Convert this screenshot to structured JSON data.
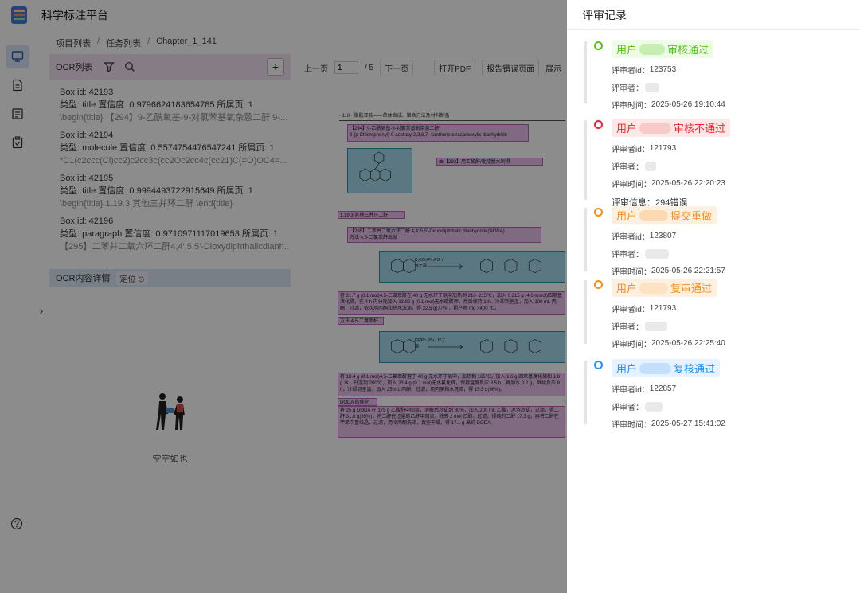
{
  "app": {
    "title": "科学标注平台",
    "breadcrumb": [
      "项目列表",
      "任务列表",
      "Chapter_1_141"
    ]
  },
  "ocr_panel": {
    "title": "OCR列表",
    "add_label": "+",
    "items": [
      {
        "box_id": "Box id: 42193",
        "meta": "类型: title   置信度: 0.9796624183654785   所属页: 1",
        "preview": "\\begin{title} 【294】9-乙酰氧基-9-对氯苯基氧杂蒽二酐 9-..."
      },
      {
        "box_id": "Box id: 42194",
        "meta": "类型: molecule   置信度: 0.5574754476547241   所属页: 1",
        "preview": "*C1(c2ccc(Cl)cc2)c2cc3c(cc2Oc2cc4c(cc21)C(=O)OC4=..."
      },
      {
        "box_id": "Box id: 42195",
        "meta": "类型: title   置信度: 0.9994493722915649   所属页: 1",
        "preview": "\\begin{title} 1.19.3 其他三并环二酐 \\end{title}"
      },
      {
        "box_id": "Box id: 42196",
        "meta": "类型: paragraph   置信度: 0.9710971117019653   所属页: 1",
        "preview": "【295】二苯并二氧六环二酐4,4',5,5'-Dioxydiphthalicdianh..."
      }
    ]
  },
  "detail_panel": {
    "title": "OCR内容详情",
    "locate_label": "定位",
    "empty_text": "空空如也"
  },
  "pdf_toolbar": {
    "prev": "上一页",
    "page": "1",
    "total": "/ 5",
    "next": "下一页",
    "open_pdf": "打开PDF",
    "report": "报告错误页面",
    "show": "展示"
  },
  "pdf_page": {
    "header": "· 118 ·                 聚酰亚胺——单体合成、聚合方法及材料制备",
    "boxes": [
      "【294】9-乙酰氧基-9-对氯苯基氧杂蒽二酐",
      "9-(p-Chlorophenyl)-9-acetoxy-2,3,6,7- xanthenetetracarboxylic dianhydride",
      "由【293】用乙酸酐/吡啶脱水制得",
      "1.19.3   其他三并环二酐",
      "【295】二苯并二氧六环二酐 4,4',5,5'-Dioxydiphthalic dianhydride(DODA)",
      "方法 4,5-二氯苯酐出发",
      "将 21.7 g (0.1 mol)4,5-二氯苯酐在 40 g 无水环丁砜中加热到 210~215℃，加入 0.215 g (4.6 mmol)四苯基溴化磷，在 4 h 内分批加入 13.82 g (0.1 mol)无水碳酸钾，然后保持 1 h。冷却到室温，加入 100 mL 丙酮，过滤，依次用丙酮和热水洗涤，得 32.5 g(77%)，粗产物 mp >400 ℃。",
      "方法 4,5-二溴苯酐出发",
      "将 18.4 g (0.1 mol)4,5-二氟苯酐溶于 40 g 无水环丁砜中，加热到 165℃，加入 1.6 g 四苯基溴化磷和 1.8 g 水，升温到 200℃，加入 23.4 g (0.1 mol)无水氟化钾，保持温度反应 3.5 h，再加水 0.2 g，继续反应 8 h，冷却到室温，加入 25 mL 丙酮，过滤，用丙酮和水洗涤，得 15.5 g(96%)。",
      "DODA 的纯化",
      "将 25 g DODA 在 175 g 乙酸酐中回流，溶解后冷却到 80%，加入 200 mL 乙酸，冰浴冷却，过滤，得二酐 31.0 g(85%)，将二酐在过量的乙酐中回流，除去 2 mol 乙酸，过滤，得纯的二酐 17.3 g，再将二酐在甲苯中重结晶，过滤，用冷丙酮洗涤，真空干燥，得 17.1 g 高纯 DODA。"
    ],
    "arrow1": "K₂CO₃/Ph₄PBr / 环丁砜",
    "arrow2": "KF/Ph₄PBr / 环丁砜"
  },
  "review": {
    "title": "评审记录",
    "records": [
      {
        "status": "green",
        "prefix": "用户",
        "action": "审核通过",
        "reviewer_id_label": "评审者id：",
        "reviewer_id": "123753",
        "reviewer_label": "评审者：",
        "time_label": "评审时间：",
        "time": "2025-05-26 19:10:44"
      },
      {
        "status": "red",
        "prefix": "用户",
        "action": "审核不通过",
        "reviewer_id_label": "评审者id：",
        "reviewer_id": "121793",
        "reviewer_label": "评审者：",
        "time_label": "评审时间：",
        "time": "2025-05-26 22:20:23",
        "info_label": "评审信息：",
        "info": "294错误"
      },
      {
        "status": "orange",
        "prefix": "用户",
        "action": "提交重做",
        "reviewer_id_label": "评审者id：",
        "reviewer_id": "123807",
        "reviewer_label": "评审者：",
        "time_label": "评审时间：",
        "time": "2025-05-26 22:21:57"
      },
      {
        "status": "orange",
        "prefix": "用户",
        "action": "复审通过",
        "reviewer_id_label": "评审者id：",
        "reviewer_id": "121793",
        "reviewer_label": "评审者：",
        "time_label": "评审时间：",
        "time": "2025-05-26 22:25:40"
      },
      {
        "status": "blue",
        "prefix": "用户",
        "action": "复核通过",
        "reviewer_id_label": "评审者id：",
        "reviewer_id": "122857",
        "reviewer_label": "评审者：",
        "time_label": "评审时间：",
        "time": "2025-05-27 15:41:02"
      }
    ]
  },
  "colors": {
    "green": "#52c41a",
    "red": "#f5222d",
    "orange": "#fa8c16",
    "blue": "#1890ff",
    "overlay": "rgba(0,0,0,0.45)"
  },
  "icons": [
    "monitor-icon",
    "document-icon",
    "list-icon",
    "clipboard-check-icon",
    "help-icon",
    "filter-icon",
    "search-icon",
    "plus-icon",
    "locate-icon",
    "chevron-right-icon"
  ]
}
